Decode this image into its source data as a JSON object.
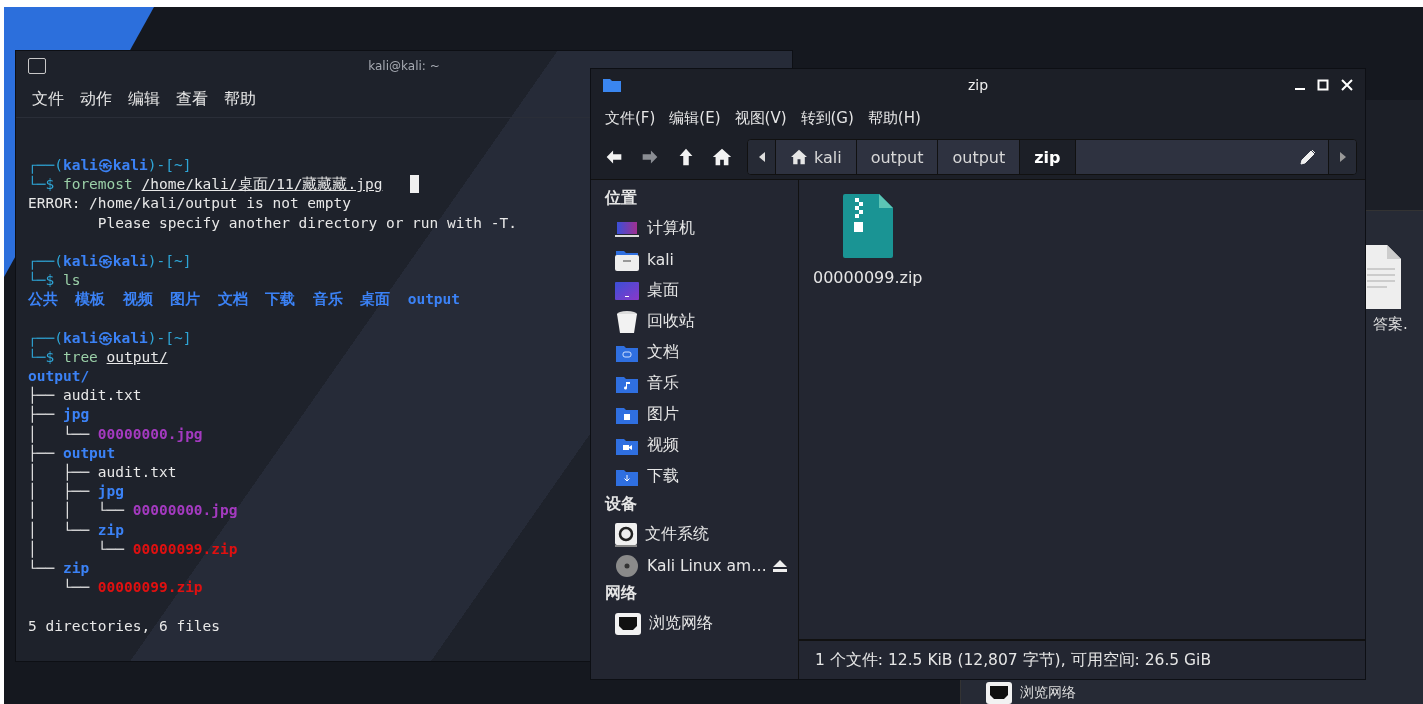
{
  "terminal": {
    "title": "kali@kali: ~",
    "menu": [
      "文件",
      "动作",
      "编辑",
      "查看",
      "帮助"
    ],
    "lines": [
      {
        "spaced": false,
        "segments": [
          {
            "kind": "frame",
            "text": "┌──("
          },
          {
            "kind": "prompt",
            "text": "kali㉿kali"
          },
          {
            "kind": "frame",
            "text": ")-[~]"
          }
        ]
      },
      {
        "spaced": false,
        "cursor": true,
        "segments": [
          {
            "kind": "frame",
            "text": "└─$ "
          },
          {
            "kind": "command",
            "text": "foremost "
          },
          {
            "kind": "path",
            "text": "/home/kali/桌面/11/藏藏藏.jpg"
          }
        ]
      },
      {
        "spaced": false,
        "segments": [
          {
            "kind": "output",
            "text": "ERROR: /home/kali/output is not empty"
          }
        ]
      },
      {
        "spaced": false,
        "segments": [
          {
            "kind": "output",
            "text": "        Please specify another directory or run with -T."
          }
        ]
      },
      {
        "spaced": true,
        "segments": [
          {
            "kind": "frame",
            "text": "┌──("
          },
          {
            "kind": "prompt",
            "text": "kali㉿kali"
          },
          {
            "kind": "frame",
            "text": ")-[~]"
          }
        ]
      },
      {
        "spaced": false,
        "segments": [
          {
            "kind": "frame",
            "text": "└─$ "
          },
          {
            "kind": "command",
            "text": "ls"
          }
        ]
      },
      {
        "spaced": false,
        "segments": [
          {
            "kind": "dir",
            "text": "公共  模板  视频  图片  文档  下载  音乐  桌面  output"
          }
        ]
      },
      {
        "spaced": true,
        "segments": [
          {
            "kind": "frame",
            "text": "┌──("
          },
          {
            "kind": "prompt",
            "text": "kali㉿kali"
          },
          {
            "kind": "frame",
            "text": ")-[~]"
          }
        ]
      },
      {
        "spaced": false,
        "segments": [
          {
            "kind": "frame",
            "text": "└─$ "
          },
          {
            "kind": "command",
            "text": "tree "
          },
          {
            "kind": "path",
            "text": "output/"
          }
        ]
      },
      {
        "spaced": false,
        "segments": [
          {
            "kind": "dir",
            "text": "output/"
          }
        ]
      },
      {
        "spaced": false,
        "segments": [
          {
            "kind": "tree",
            "text": "├── "
          },
          {
            "kind": "output",
            "text": "audit.txt"
          }
        ]
      },
      {
        "spaced": false,
        "segments": [
          {
            "kind": "tree",
            "text": "├── "
          },
          {
            "kind": "dir",
            "text": "jpg"
          }
        ]
      },
      {
        "spaced": false,
        "segments": [
          {
            "kind": "tree",
            "text": "│   └── "
          },
          {
            "kind": "image",
            "text": "00000000.jpg"
          }
        ]
      },
      {
        "spaced": false,
        "segments": [
          {
            "kind": "tree",
            "text": "├── "
          },
          {
            "kind": "dir",
            "text": "output"
          }
        ]
      },
      {
        "spaced": false,
        "segments": [
          {
            "kind": "tree",
            "text": "│   ├── "
          },
          {
            "kind": "output",
            "text": "audit.txt"
          }
        ]
      },
      {
        "spaced": false,
        "segments": [
          {
            "kind": "tree",
            "text": "│   ├── "
          },
          {
            "kind": "dir",
            "text": "jpg"
          }
        ]
      },
      {
        "spaced": false,
        "segments": [
          {
            "kind": "tree",
            "text": "│   │   └── "
          },
          {
            "kind": "image",
            "text": "00000000.jpg"
          }
        ]
      },
      {
        "spaced": false,
        "segments": [
          {
            "kind": "tree",
            "text": "│   └── "
          },
          {
            "kind": "dir",
            "text": "zip"
          }
        ]
      },
      {
        "spaced": false,
        "segments": [
          {
            "kind": "tree",
            "text": "│       └── "
          },
          {
            "kind": "archive",
            "text": "00000099.zip"
          }
        ]
      },
      {
        "spaced": false,
        "segments": [
          {
            "kind": "tree",
            "text": "└── "
          },
          {
            "kind": "dir",
            "text": "zip"
          }
        ]
      },
      {
        "spaced": false,
        "segments": [
          {
            "kind": "tree",
            "text": "    └── "
          },
          {
            "kind": "archive",
            "text": "00000099.zip"
          }
        ]
      },
      {
        "spaced": true,
        "segments": [
          {
            "kind": "output",
            "text": "5 directories, 6 files"
          }
        ]
      }
    ]
  },
  "file_manager": {
    "title": "zip",
    "menu": [
      "文件(F)",
      "编辑(E)",
      "视图(V)",
      "转到(G)",
      "帮助(H)"
    ],
    "nav_buttons": [
      {
        "kind": "back",
        "disabled": false
      },
      {
        "kind": "forward",
        "disabled": true
      },
      {
        "kind": "up",
        "disabled": false
      },
      {
        "kind": "home",
        "disabled": false
      }
    ],
    "breadcrumb": [
      {
        "label": "kali",
        "kind": "home",
        "selected": false
      },
      {
        "label": "output",
        "kind": "folder",
        "selected": false
      },
      {
        "label": "output",
        "kind": "folder",
        "selected": false
      },
      {
        "label": "zip",
        "kind": "folder",
        "selected": true
      }
    ],
    "sidebar": [
      {
        "heading": "位置",
        "items": [
          {
            "label": "计算机",
            "kind": "computer"
          },
          {
            "label": "kali",
            "kind": "home"
          },
          {
            "label": "桌面",
            "kind": "desktop"
          },
          {
            "label": "回收站",
            "kind": "trash"
          },
          {
            "label": "文档",
            "kind": "documents"
          },
          {
            "label": "音乐",
            "kind": "music"
          },
          {
            "label": "图片",
            "kind": "pictures"
          },
          {
            "label": "视频",
            "kind": "videos"
          },
          {
            "label": "下载",
            "kind": "downloads"
          }
        ]
      },
      {
        "heading": "设备",
        "items": [
          {
            "label": "文件系统",
            "kind": "drive"
          },
          {
            "label": "Kali Linux am…",
            "kind": "disc",
            "ejectable": true
          }
        ]
      },
      {
        "heading": "网络",
        "items": [
          {
            "label": "浏览网络",
            "kind": "network"
          }
        ]
      }
    ],
    "files": [
      {
        "name": "00000099.zip",
        "kind": "archive"
      }
    ],
    "status": "1 个文件: 12.5 KiB (12,807 字节), 可用空间: 26.5 GiB"
  },
  "background_window": {
    "file_label": "答案.",
    "sidebar_item": "浏览网络"
  }
}
